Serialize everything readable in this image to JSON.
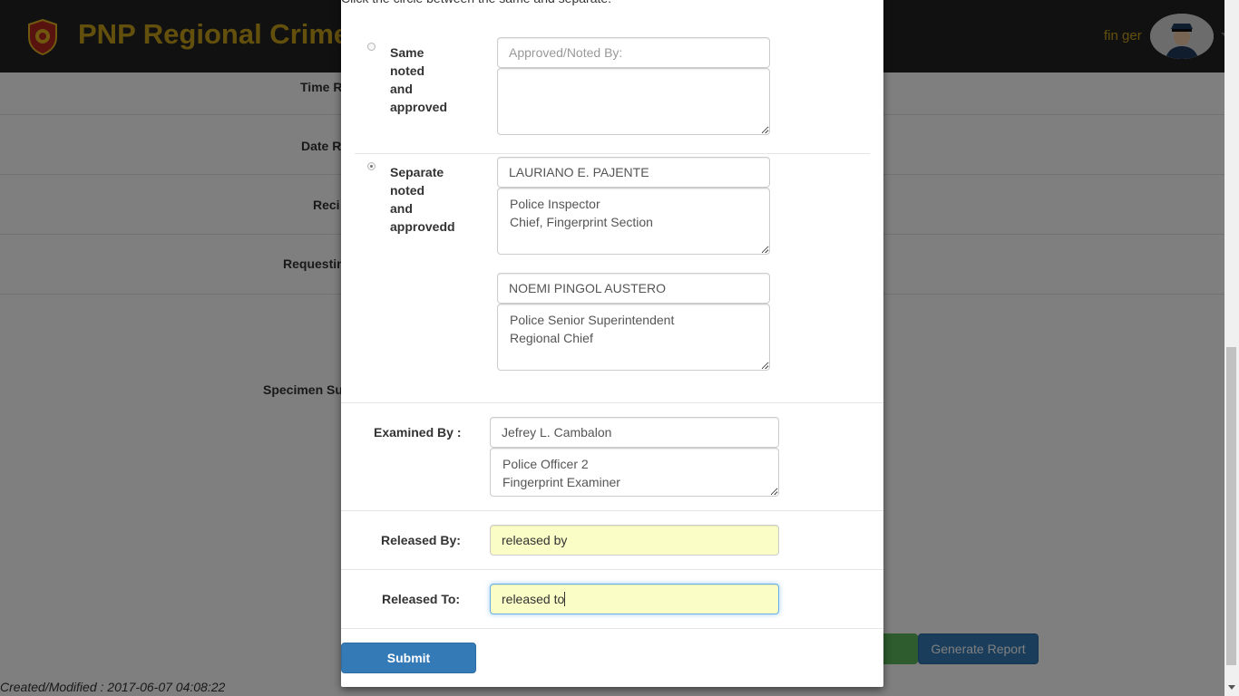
{
  "navbar": {
    "brand": "PNP Regional Crime",
    "username": "fin ger"
  },
  "background": {
    "labels": [
      "Time R",
      "Date R",
      "Reci",
      "Requestin",
      "Specimen Su"
    ],
    "created": "Created/Modified : 2017-06-07 04:08:22",
    "generate_report": "Generate Report"
  },
  "modal": {
    "instruction": "Click the circle between the same and separate:",
    "same_option": {
      "label_lines": [
        "Same",
        "noted",
        "and",
        "approved"
      ],
      "selected": false,
      "input_placeholder": "Approved/Noted By:",
      "textarea_value": ""
    },
    "separate_option": {
      "label_lines": [
        "Separate",
        "noted",
        "and",
        "approvedd"
      ],
      "selected": true,
      "noted_by_name": "LAURIANO E. PAJENTE",
      "noted_by_title_line1": "Police Inspector",
      "noted_by_title_line2": "Chief, Fingerprint Section",
      "approved_by_name": "NOEMI PINGOL AUSTERO",
      "approved_by_title_line1": "Police Senior Superintendent",
      "approved_by_title_line2": "Regional Chief"
    },
    "examined_by": {
      "label": "Examined By :",
      "name": "Jefrey L. Cambalon",
      "title_line1": "Police Officer 2",
      "title_line2": "Fingerprint Examiner"
    },
    "released_by": {
      "label": "Released By:",
      "value": "released by"
    },
    "released_to": {
      "label": "Released To:",
      "value": "released to"
    },
    "submit_label": "Submit"
  },
  "colors": {
    "navbar_bg": "#222222",
    "brand_gold": "#c8a11a",
    "primary_blue": "#337ab7",
    "success_green": "#5cb85c",
    "autofill_yellow": "#fafdc6"
  }
}
